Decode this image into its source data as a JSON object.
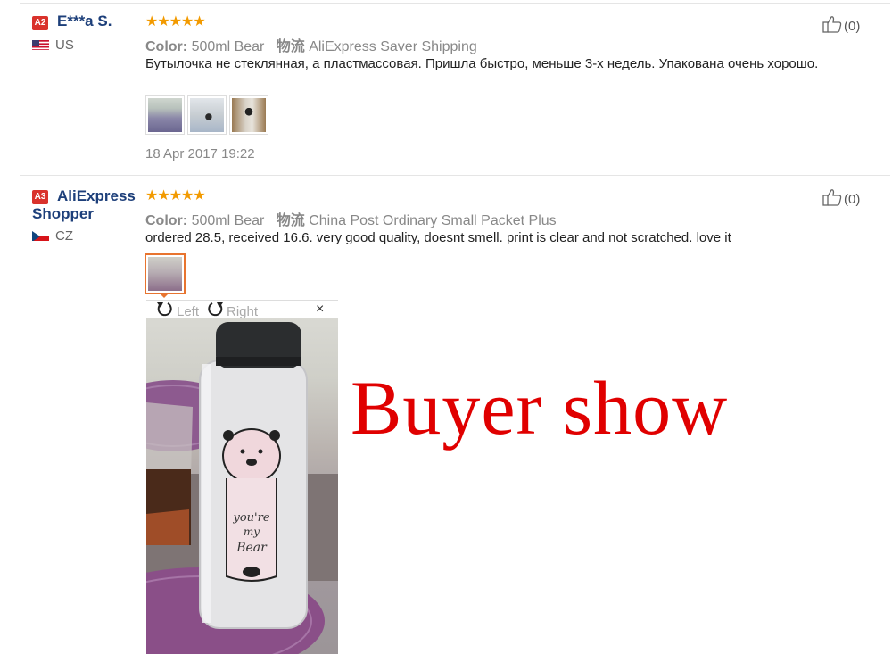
{
  "reviews": [
    {
      "level": "A2",
      "name": "E***a S.",
      "country": "US",
      "stars": "★★★★★",
      "color_label": "Color:",
      "color_value": "500ml Bear",
      "logistics_label": "物流",
      "logistics_value": "AliExpress Saver Shipping",
      "text": "Бутылочка не стеклянная, а пластмассовая. Пришла быстро, меньше 3-х недель. Упакована очень хорошо.",
      "date": "18 Apr 2017 19:22",
      "helpful_count": "(0)"
    },
    {
      "level": "A3",
      "name_line1": "AliExpress",
      "name_line2": "Shopper",
      "country": "CZ",
      "stars": "★★★★★",
      "color_label": "Color:",
      "color_value": "500ml Bear",
      "logistics_label": "物流",
      "logistics_value": "China Post Ordinary Small Packet Plus",
      "text": "ordered 28.5, received 16.6. very good quality, doesnt smell. print is clear and not scratched. love it",
      "helpful_count": "(0)"
    }
  ],
  "viewer": {
    "left_label": "Left",
    "right_label": "Right",
    "close_label": "×"
  },
  "photo_text": {
    "line1": "you're",
    "line2": "my",
    "line3": "Bear"
  },
  "overlay_caption": "Buyer show",
  "icons": [
    "thumbs-up-icon",
    "rotate-left-icon",
    "rotate-right-icon",
    "close-icon",
    "us-flag-icon",
    "cz-flag-icon",
    "star-icon"
  ],
  "colors": {
    "accent_red": "#e00000",
    "star_orange": "#f29a00",
    "name_blue": "#1d3f7a",
    "selected_border": "#e8742f"
  }
}
